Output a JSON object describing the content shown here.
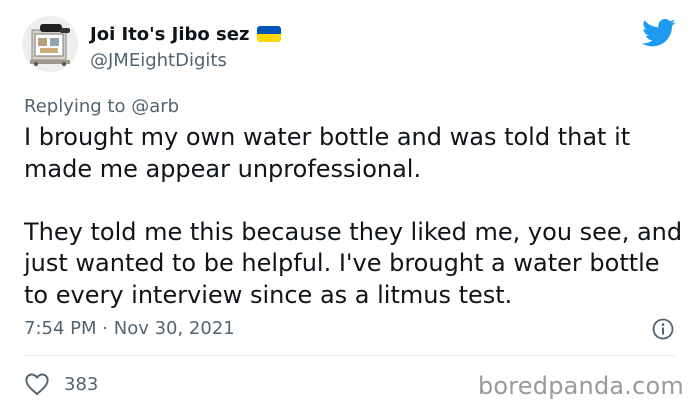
{
  "author": {
    "display_name": "Joi Ito's Jibo sez",
    "handle": "@JMEightDigits",
    "flag": "ukraine-flag-icon",
    "avatar": "robot-avatar"
  },
  "reply_context": {
    "prefix": "Replying to",
    "mention": "@arb"
  },
  "tweet": {
    "paragraphs": [
      "I brought my own water bottle and was told that it made me appear unprofessional.",
      "They told me this because they liked me, you see, and just wanted to be helpful. I've brought a water bottle to every interview since as a litmus test."
    ],
    "time": "7:54 PM",
    "separator": "·",
    "date": "Nov 30, 2021"
  },
  "engagement": {
    "likes": "383"
  },
  "watermark": "boredpanda.com",
  "colors": {
    "twitter_blue": "#1d9bf0",
    "text_primary": "#0f1419",
    "text_secondary": "#536471",
    "divider": "#e6ecf0",
    "flag_blue": "#0057b7",
    "flag_yellow": "#ffd700"
  }
}
